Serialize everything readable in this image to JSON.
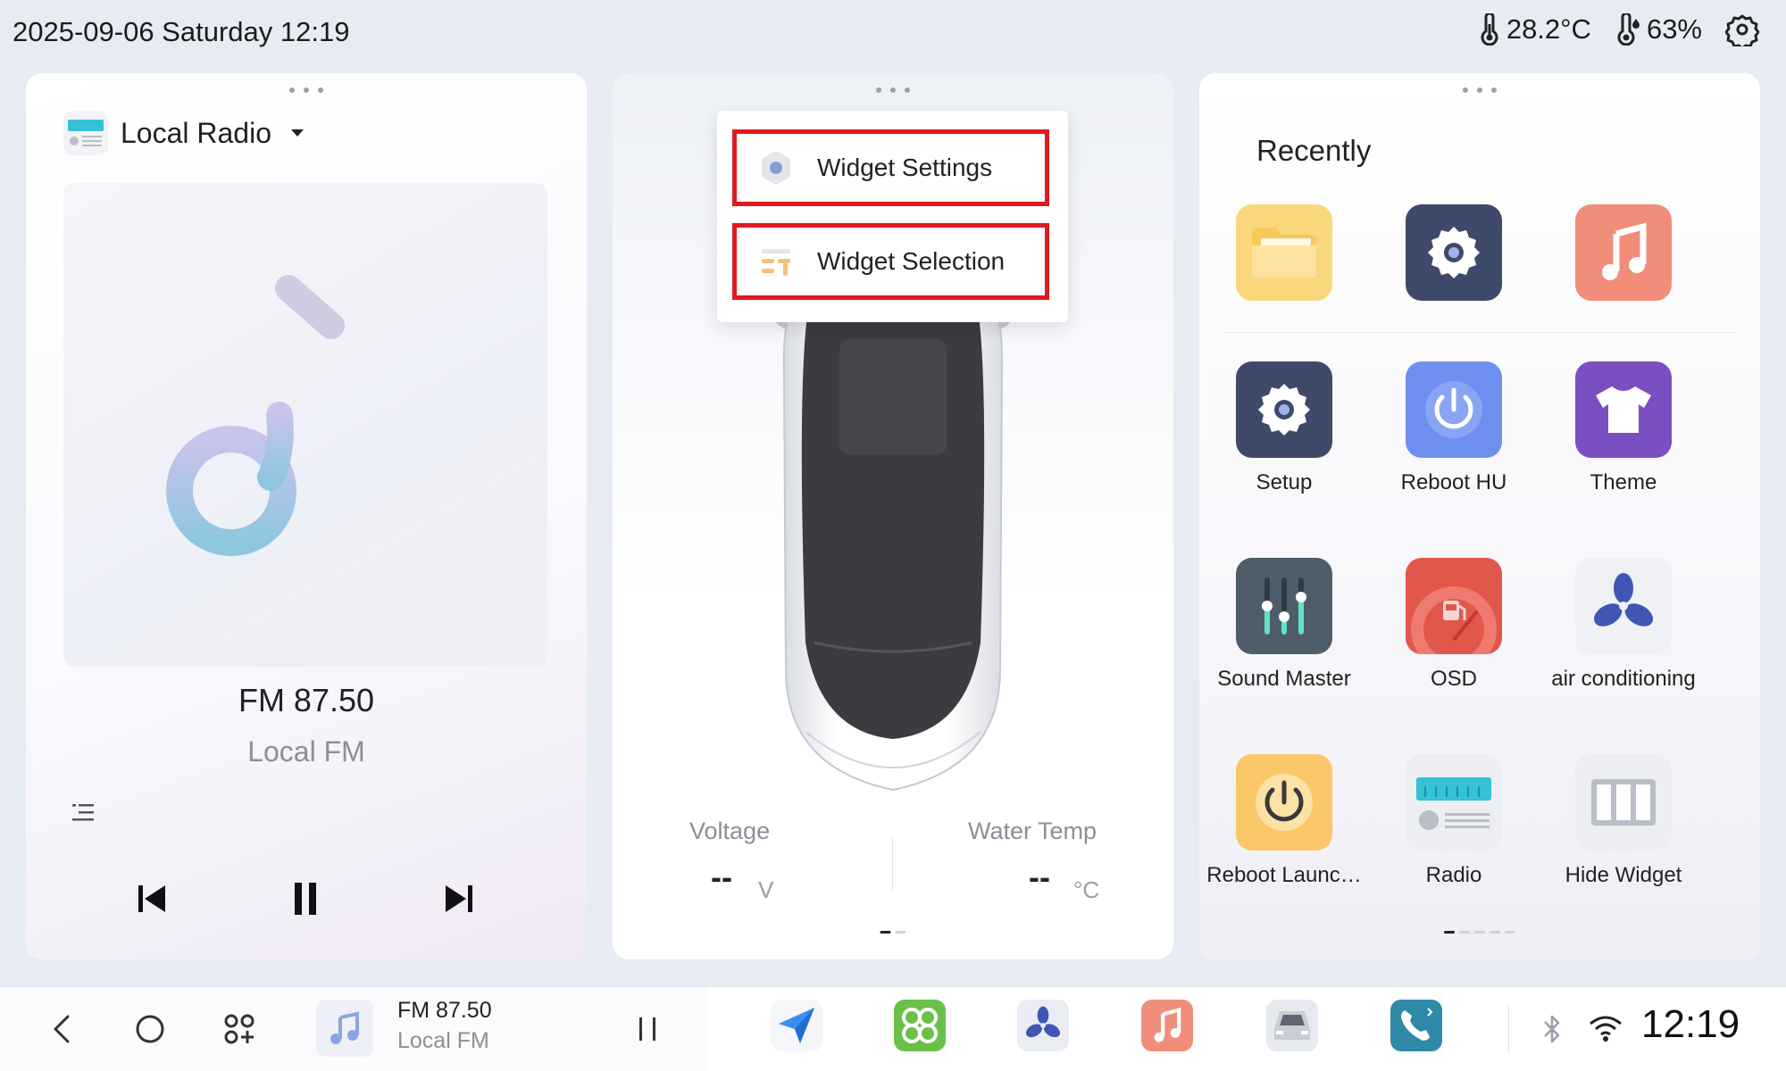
{
  "status": {
    "datetime": "2025-09-06 Saturday 12:19",
    "temperature": "28.2°C",
    "humidity": "63%",
    "icons": [
      "thermometer-icon",
      "humidity-icon",
      "settings-gear-icon"
    ]
  },
  "left_card": {
    "source_label": "Local Radio",
    "frequency": "FM 87.50",
    "station": "Local FM",
    "icons": [
      "radio-icon",
      "dropdown-caret-icon",
      "music-note-icon",
      "playlist-icon",
      "previous-icon",
      "pause-icon",
      "next-icon"
    ]
  },
  "popup_menu": {
    "items": [
      {
        "label": "Widget Settings",
        "icon": "gear-hex-icon"
      },
      {
        "label": "Widget Selection",
        "icon": "widget-selection-icon"
      }
    ],
    "highlight_color": "#e0191d"
  },
  "middle_card": {
    "voltage_label": "Voltage",
    "voltage_value": "--",
    "voltage_unit": "V",
    "water_temp_label": "Water Temp",
    "water_temp_value": "--",
    "water_temp_unit": "°C",
    "icons": [
      "car-top-view-icon"
    ]
  },
  "right_card": {
    "title": "Recently",
    "recent_apps": [
      {
        "name": "",
        "icon": "folder-icon",
        "color": "#fbd77c"
      },
      {
        "name": "",
        "icon": "settings-icon",
        "color": "#3f4a6b"
      },
      {
        "name": "",
        "icon": "music-icon",
        "color": "#f08e7a"
      }
    ],
    "apps": [
      {
        "name": "Setup",
        "icon": "settings-icon",
        "color": "#3f4a6b"
      },
      {
        "name": "Reboot HU",
        "icon": "power-icon",
        "color": "#6f8ff0"
      },
      {
        "name": "Theme",
        "icon": "tshirt-icon",
        "color": "#7a4fc0"
      },
      {
        "name": "Sound Master",
        "icon": "equalizer-icon",
        "color": "#4f5d6a"
      },
      {
        "name": "OSD",
        "icon": "fuel-gauge-icon",
        "color": "#e2574c"
      },
      {
        "name": "air conditioning",
        "icon": "fan-icon",
        "color": "#f0f1f4"
      },
      {
        "name": "Reboot Launc…",
        "icon": "power-icon",
        "color": "#fbc869"
      },
      {
        "name": "Radio",
        "icon": "radio-icon",
        "color": "#eceef2"
      },
      {
        "name": "Hide Widget",
        "icon": "columns-icon",
        "color": "#eceef2"
      }
    ]
  },
  "bottom_bar": {
    "mini_frequency": "FM 87.50",
    "mini_station": "Local FM",
    "clock": "12:19",
    "nav_icons": [
      "back-icon",
      "home-icon",
      "apps-grid-icon"
    ],
    "dock": [
      {
        "icon": "navigation-icon",
        "color": "#3a8ef0"
      },
      {
        "icon": "app-launcher-icon",
        "color": "#6cc04a"
      },
      {
        "icon": "fan-icon",
        "color": "#e9ecf2"
      },
      {
        "icon": "music-icon",
        "color": "#f08e7a"
      },
      {
        "icon": "car-icon",
        "color": "#e6e9ef"
      },
      {
        "icon": "phone-icon",
        "color": "#2f8aa8"
      }
    ],
    "status_icons": [
      "bluetooth-icon",
      "wifi-icon"
    ]
  }
}
